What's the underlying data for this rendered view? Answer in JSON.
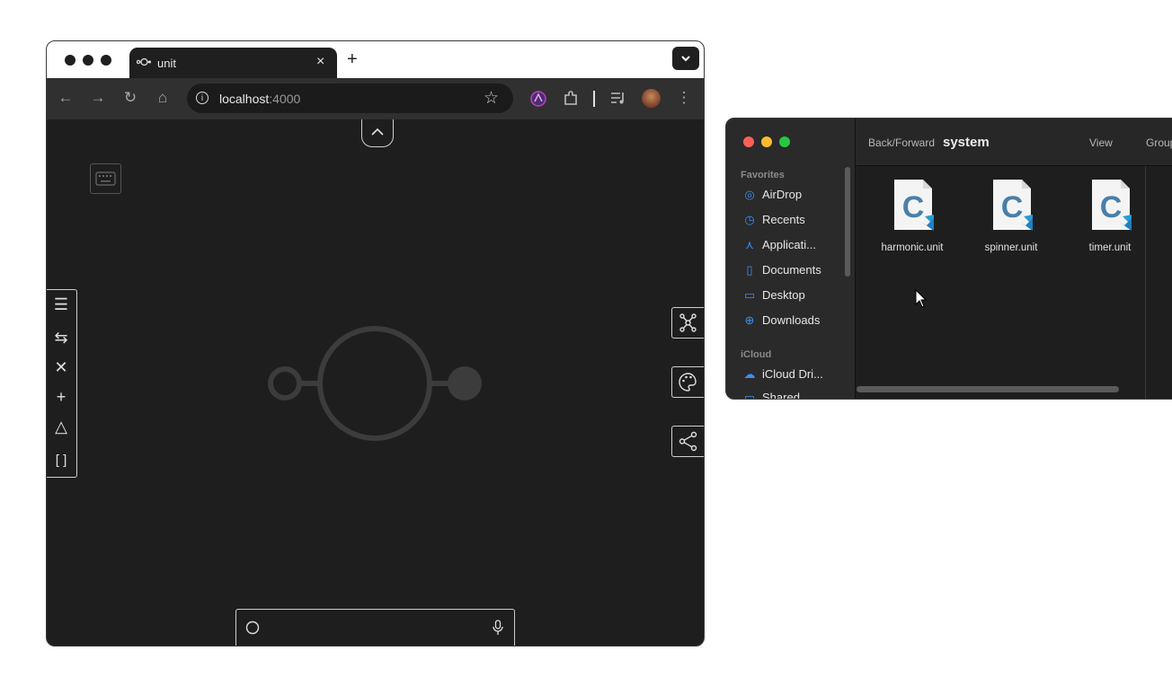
{
  "browser": {
    "tab": {
      "title": "unit",
      "close_glyph": "×"
    },
    "new_tab_glyph": "+",
    "tab_menu_glyph": "⌄",
    "toolbar": {
      "back_glyph": "←",
      "forward_glyph": "→",
      "reload_glyph": "↻",
      "home_glyph": "⌂",
      "url_host": "localhost",
      "url_port": ":4000",
      "info_glyph": "i",
      "bookmark_glyph": "☆",
      "menu_glyph": "⋮"
    }
  },
  "page": {
    "left_tools": [
      {
        "name": "menu-tool",
        "glyph": "☰"
      },
      {
        "name": "swap-tool",
        "glyph": "⇆"
      },
      {
        "name": "remove-tool",
        "glyph": "✕"
      },
      {
        "name": "add-tool",
        "glyph": "+"
      },
      {
        "name": "triangle-tool",
        "glyph": "△"
      },
      {
        "name": "bracket-tool",
        "glyph": "[ ]"
      }
    ],
    "right_tools": [
      {
        "name": "graph-tool",
        "icon": "graph-icon"
      },
      {
        "name": "palette-tool",
        "icon": "palette-icon"
      },
      {
        "name": "share-tool",
        "icon": "share-icon"
      }
    ],
    "colors": {
      "background": "#1e1e1e",
      "unit_stroke": "#3c3c3c",
      "border": "#cfcfcf"
    }
  },
  "finder": {
    "title": "system",
    "back_forward": "Back/Forward",
    "view": "View",
    "group": "Group",
    "favorites_label": "Favorites",
    "favorites": [
      {
        "label": "AirDrop",
        "icon": "airdrop-icon",
        "glyph": "◎"
      },
      {
        "label": "Recents",
        "icon": "clock-icon",
        "glyph": "◷"
      },
      {
        "label": "Applicati...",
        "icon": "applications-icon",
        "glyph": "⋏"
      },
      {
        "label": "Documents",
        "icon": "document-icon",
        "glyph": "▯"
      },
      {
        "label": "Desktop",
        "icon": "desktop-icon",
        "glyph": "▭"
      },
      {
        "label": "Downloads",
        "icon": "download-icon",
        "glyph": "⊕"
      }
    ],
    "icloud_label": "iCloud",
    "icloud": [
      {
        "label": "iCloud Dri...",
        "icon": "cloud-icon",
        "glyph": "☁"
      },
      {
        "label": "Shared",
        "icon": "shared-folder-icon",
        "glyph": "▭"
      }
    ],
    "files": [
      {
        "name": "harmonic.unit",
        "letter": "C"
      },
      {
        "name": "spinner.unit",
        "letter": "C"
      },
      {
        "name": "timer.unit",
        "letter": "C"
      }
    ],
    "colors": {
      "close": "#ff5f57",
      "minimize": "#febc2e",
      "zoom": "#28c840",
      "accent": "#3b8ff0"
    }
  }
}
